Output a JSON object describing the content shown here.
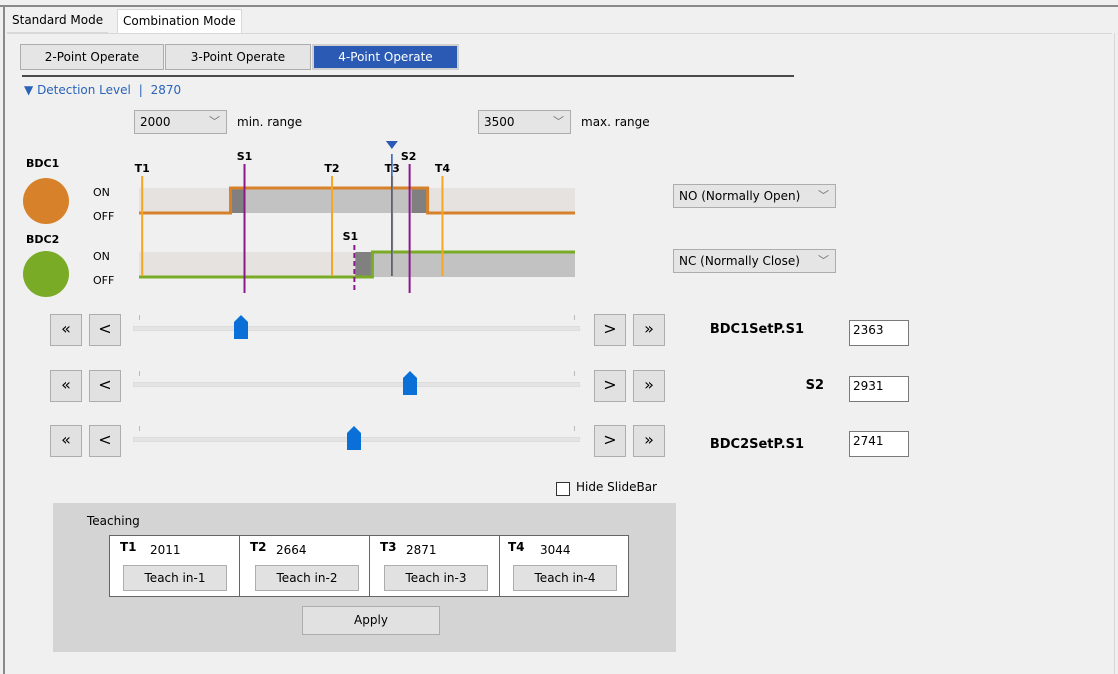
{
  "tabs": [
    {
      "label": "Standard Mode",
      "active": false
    },
    {
      "label": "Combination Mode",
      "active": true
    }
  ],
  "modes": [
    {
      "label": "2-Point Operate",
      "active": false
    },
    {
      "label": "3-Point Operate",
      "active": false
    },
    {
      "label": "4-Point Operate",
      "active": true
    }
  ],
  "detection": {
    "label": "Detection Level",
    "separator": "|",
    "value": 2870
  },
  "range": {
    "min_value": "2000",
    "min_label": "min. range",
    "max_value": "3500",
    "max_label": "max. range"
  },
  "timing": {
    "range_min": 2000,
    "range_max": 3500,
    "detection_level": 2870,
    "teach_points": [
      {
        "label": "T1",
        "value": 2011
      },
      {
        "label": "T2",
        "value": 2664
      },
      {
        "label": "T3",
        "value": 2871
      },
      {
        "label": "T4",
        "value": 3044
      }
    ],
    "bdc1": {
      "name": "BDC1",
      "color": "#d7822a",
      "on_label": "ON",
      "off_label": "OFF",
      "mode": "NO (Normally Open)",
      "setpoints": [
        {
          "label": "S1",
          "value": 2363
        },
        {
          "label": "S2",
          "value": 2931
        }
      ]
    },
    "bdc2": {
      "name": "BDC2",
      "color": "#7aab27",
      "on_label": "ON",
      "off_label": "OFF",
      "mode": "NC (Normally Close)",
      "setpoints": [
        {
          "label": "S1",
          "value": 2741
        }
      ]
    },
    "colors": {
      "teach": "#f5a623",
      "setpoint": "#8a1a8a",
      "detection": "#2a5ab4",
      "band_light": "#e6e2e0",
      "band_active": "#c2c2c2",
      "hysteresis": "#808080"
    }
  },
  "sliders": [
    {
      "label": "BDC1SetP.S1",
      "value": "2363",
      "fraction": 0.242
    },
    {
      "label": "S2",
      "value": "2931",
      "fraction": 0.6207
    },
    {
      "label": "BDC2SetP.S1",
      "value": "2741",
      "fraction": 0.494
    }
  ],
  "nav": {
    "first": "«",
    "prev": "<",
    "next": ">",
    "last": "»"
  },
  "hide_slidebar": {
    "label": "Hide SlideBar",
    "checked": false
  },
  "teaching": {
    "title": "Teaching",
    "cells": [
      {
        "name": "T1",
        "value": "2011",
        "button": "Teach in-1"
      },
      {
        "name": "T2",
        "value": "2664",
        "button": "Teach in-2"
      },
      {
        "name": "T3",
        "value": "2871",
        "button": "Teach in-3"
      },
      {
        "name": "T4",
        "value": "3044",
        "button": "Teach in-4"
      }
    ],
    "apply": "Apply"
  }
}
